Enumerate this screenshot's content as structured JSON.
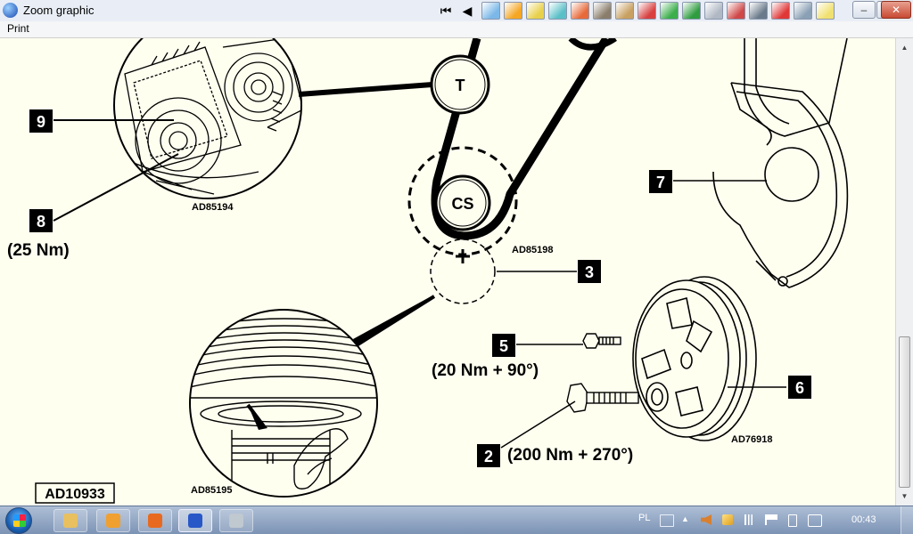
{
  "window": {
    "title": "Zoom graphic"
  },
  "menu": {
    "print": "Print"
  },
  "window_controls": {
    "minimize": "–",
    "restore": "❐",
    "close": "✕"
  },
  "toolbar": {
    "nav_first": "⏮",
    "nav_prev": "◀",
    "buttons": [
      {
        "icon": "diagram-icon",
        "color": "#7bb8e8"
      },
      {
        "icon": "gear-icon",
        "color": "#f5a623"
      },
      {
        "icon": "wrench-icon",
        "color": "#e8d04a"
      },
      {
        "icon": "engine-icon",
        "color": "#5ac0c8"
      },
      {
        "icon": "car-icon",
        "color": "#e86a3a"
      },
      {
        "icon": "gauge-icon",
        "color": "#8a7d6b"
      },
      {
        "icon": "tool-icon",
        "color": "#c8a060"
      },
      {
        "icon": "bulb-icon",
        "color": "#d84040"
      },
      {
        "icon": "checklist-icon",
        "color": "#3cae4c"
      },
      {
        "icon": "document-icon",
        "color": "#2f9d3f"
      },
      {
        "icon": "spanner-icon",
        "color": "#b0b8c4"
      },
      {
        "icon": "brake-icon",
        "color": "#d04848"
      },
      {
        "icon": "battery-icon",
        "color": "#6a7a8a"
      },
      {
        "icon": "warning-icon",
        "color": "#e03838"
      },
      {
        "icon": "chassis-icon",
        "color": "#8aa0b4"
      },
      {
        "icon": "note-icon",
        "color": "#f0e070"
      }
    ]
  },
  "diagram": {
    "callouts": {
      "c2": "2",
      "c3": "3",
      "c5": "5",
      "c6": "6",
      "c7": "7",
      "c8": "8",
      "c9": "9"
    },
    "torques": {
      "c8": "(25 Nm)",
      "c5": "(20 Nm + 90°)",
      "c2": "(200 Nm + 270°)"
    },
    "pulleys": {
      "tensioner": "T",
      "crankshaft": "CS"
    },
    "refs": {
      "top_left": "AD85194",
      "belt": "AD85198",
      "bottom_left": "AD85195",
      "pulley": "AD76918",
      "figure": "AD10933"
    }
  },
  "taskbar": {
    "apps": [
      {
        "icon": "explorer-icon",
        "color": "#e8c060"
      },
      {
        "icon": "media-player-icon",
        "color": "#f0a030"
      },
      {
        "icon": "firefox-icon",
        "color": "#e86a20"
      },
      {
        "icon": "app-icon",
        "color": "#2858c8"
      },
      {
        "icon": "tool-app-icon",
        "color": "#c0c8d0"
      }
    ],
    "language": "PL",
    "clock": "00:43"
  }
}
